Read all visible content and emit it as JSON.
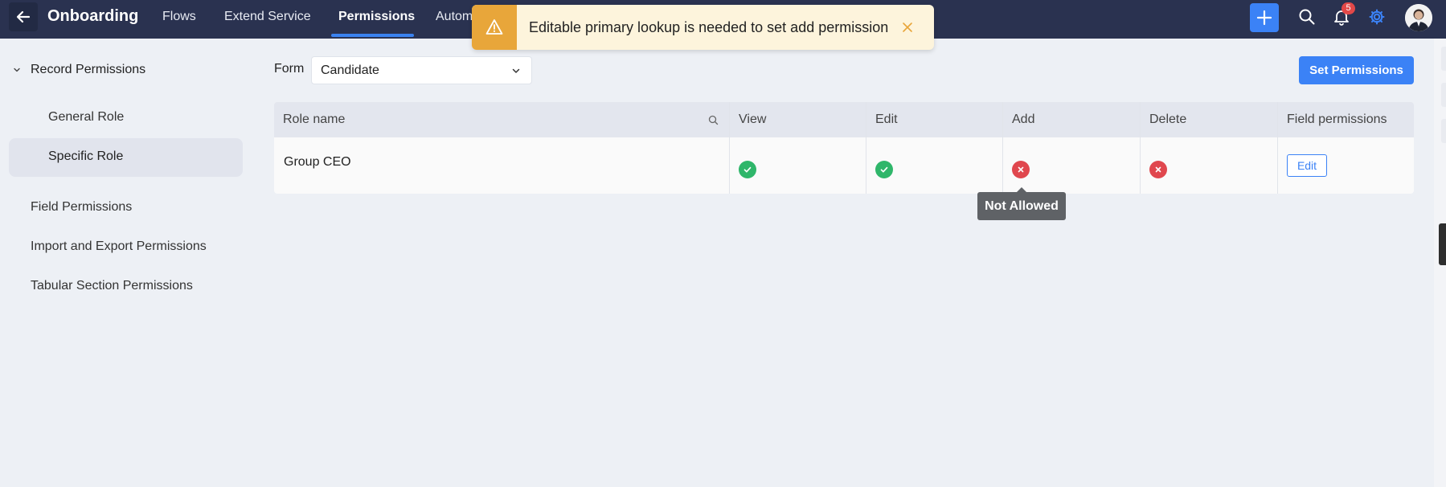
{
  "app": {
    "title": "Onboarding"
  },
  "nav": {
    "tabs": [
      {
        "label": "Flows"
      },
      {
        "label": "Extend Service"
      },
      {
        "label": "Permissions"
      },
      {
        "label": "Autom"
      }
    ],
    "active_tab": "Permissions",
    "notification_count": "5",
    "icons": [
      "back-arrow-icon",
      "plus-icon",
      "search-icon",
      "bell-icon",
      "gear-icon",
      "user-avatar"
    ]
  },
  "toast": {
    "message": "Editable primary lookup is needed to set add permission",
    "icon": "warning-icon",
    "accent_color": "#e8a63a",
    "background": "#fdf4dc"
  },
  "sidebar": {
    "group_label": "Record Permissions",
    "subitems": [
      {
        "label": "General Role"
      },
      {
        "label": "Specific Role"
      }
    ],
    "active_subitem": "Specific Role",
    "items": [
      {
        "label": "Field Permissions"
      },
      {
        "label": "Import and Export Permissions"
      },
      {
        "label": "Tabular Section Permissions"
      }
    ]
  },
  "form": {
    "label": "Form",
    "selected": "Candidate"
  },
  "actions": {
    "set_permissions": "Set Permissions"
  },
  "table": {
    "headers": {
      "role_name": "Role name",
      "view": "View",
      "edit": "Edit",
      "add": "Add",
      "delete": "Delete",
      "field_permissions": "Field permissions"
    },
    "rows": [
      {
        "role_name": "Group CEO",
        "view": "allowed",
        "edit": "allowed",
        "add": "denied",
        "delete": "denied",
        "field_permissions_action": "Edit"
      }
    ]
  },
  "tooltip": {
    "text": "Not Allowed"
  },
  "colors": {
    "topbar": "#2a3250",
    "accent": "#3b82f6",
    "allowed": "#2fb66a",
    "denied": "#e0474e"
  }
}
